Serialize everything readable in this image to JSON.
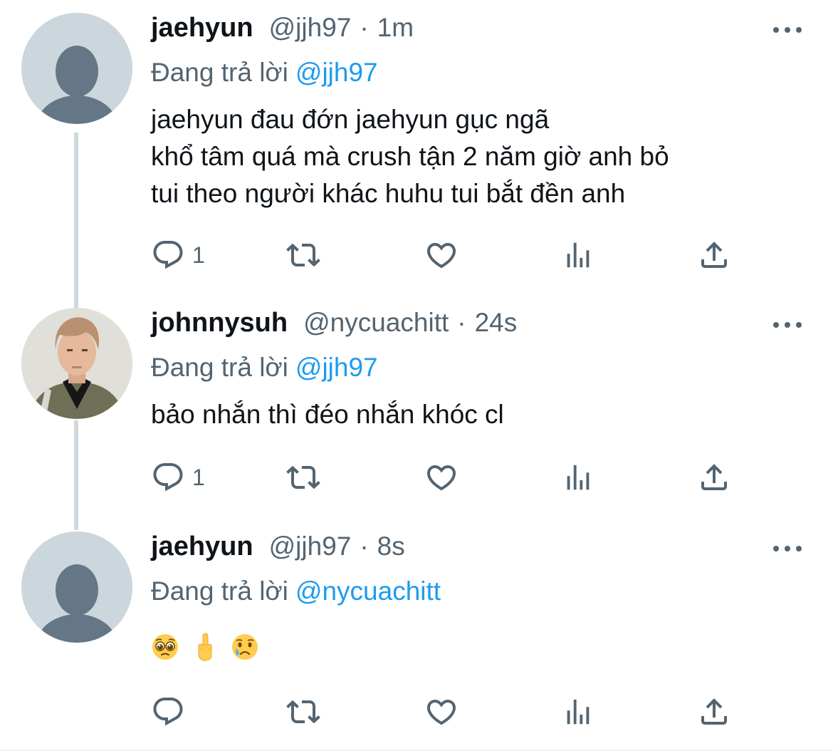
{
  "colors": {
    "text_primary": "#0f1419",
    "text_secondary": "#536471",
    "mention_blue": "#1d9bf0",
    "thread_line": "#cfd9de"
  },
  "reply_prefix": "Đang trả lời",
  "tweets": [
    {
      "display_name": "jaehyun",
      "handle": "@jjh97",
      "separator": "·",
      "time": "1m",
      "reply_to": "@jjh97",
      "text": "jaehyun đau đớn jaehyun gục ngã\nkhổ tâm quá mà crush tận 2 năm giờ anh bỏ\ntui theo người khác huhu tui bắt đền anh",
      "reply_count": "1",
      "avatar": "default-avatar-icon"
    },
    {
      "display_name": "johnnysuh",
      "handle": "@nycuachitt",
      "separator": "·",
      "time": "24s",
      "reply_to": "@jjh97",
      "text": "bảo nhắn thì đéo nhắn khóc cl",
      "reply_count": "1",
      "avatar": "profile-photo"
    },
    {
      "display_name": "jaehyun",
      "handle": "@jjh97",
      "separator": "·",
      "time": "8s",
      "reply_to": "@nycuachitt",
      "emojis": [
        "pleading-face",
        "middle-finger",
        "crying-face"
      ],
      "reply_count": "",
      "avatar": "default-avatar-icon"
    }
  ]
}
